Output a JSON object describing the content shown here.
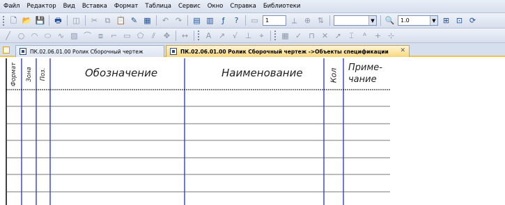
{
  "menu": [
    "Файл",
    "Редактор",
    "Вид",
    "Вставка",
    "Формат",
    "Таблица",
    "Сервис",
    "Окно",
    "Справка",
    "Библиотеки"
  ],
  "toolbar1": {
    "layer_value": "1",
    "zoom_value": "1.0"
  },
  "tabs": [
    {
      "label": "ПК.02.06.01.00 Ролик Сборочный чертеж",
      "active": false
    },
    {
      "label": "ПК.02.06.01.00 Ролик Сборочный чертеж ->Объекты спецификации",
      "active": true
    }
  ],
  "spec_table": {
    "headers": {
      "format": "Формат",
      "zone": "Зона",
      "pos": "Поз.",
      "designation": "Обозначение",
      "name": "Наименование",
      "qty": "Кол",
      "note_line1": "Приме-",
      "note_line2": "чание"
    },
    "rows": [
      "",
      "",
      "",
      "",
      "",
      "",
      ""
    ]
  },
  "colors": {
    "grid_blue": "#1f2fd0",
    "tab_active": "#f8d77c",
    "menubar": "#dde4f1"
  }
}
